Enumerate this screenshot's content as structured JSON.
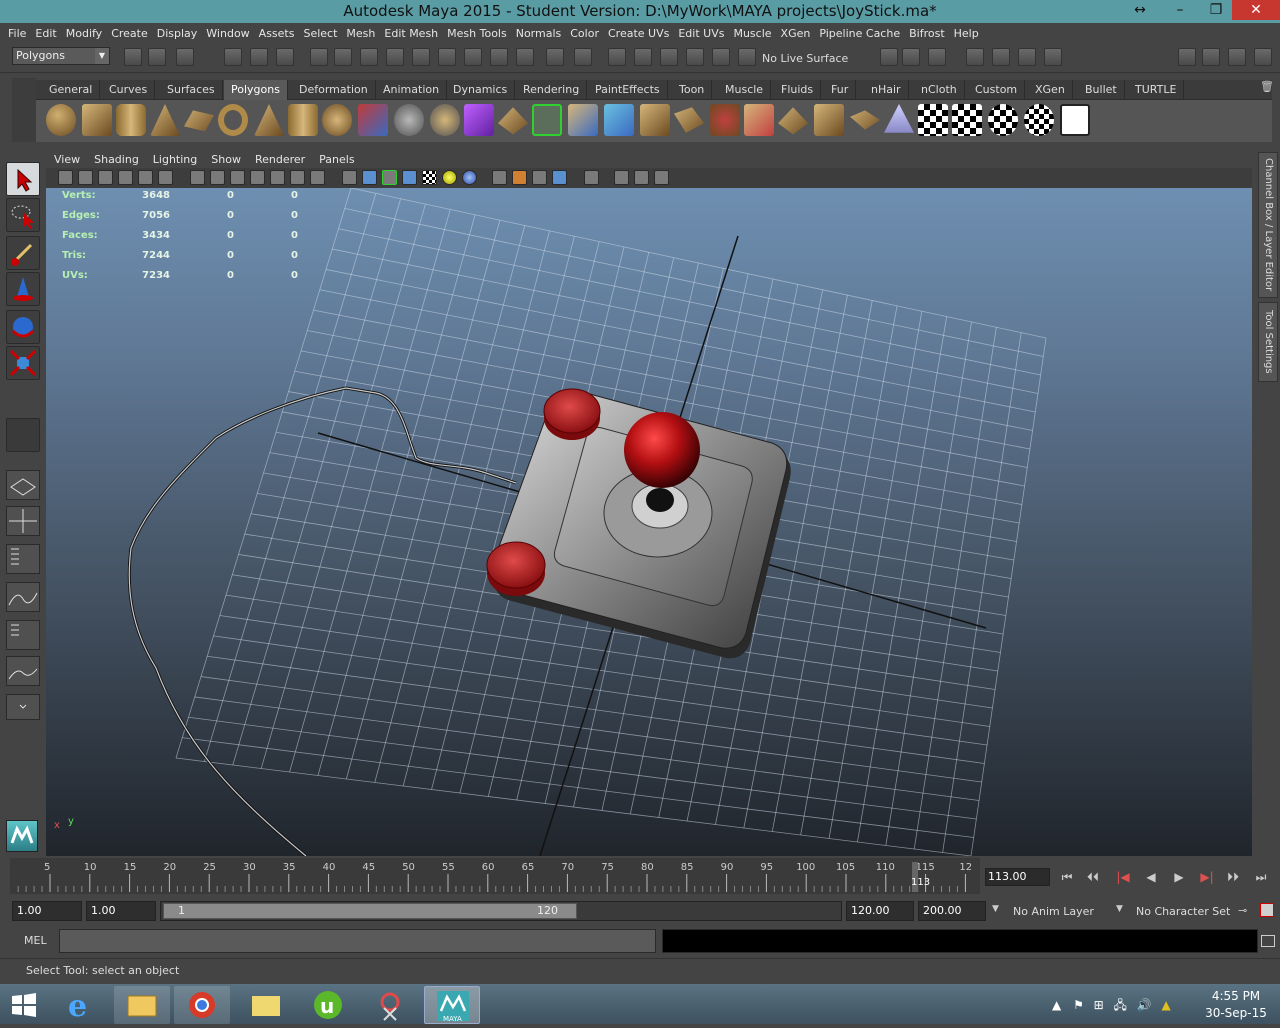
{
  "window": {
    "title": "Autodesk Maya 2015 - Student Version: D:\\MyWork\\MAYA projects\\JoyStick.ma*",
    "restore_glyph": "↔",
    "min_glyph": "–",
    "max_glyph": "❐",
    "close_glyph": "✕"
  },
  "menubar": [
    "File",
    "Edit",
    "Modify",
    "Create",
    "Display",
    "Window",
    "Assets",
    "Select",
    "Mesh",
    "Edit Mesh",
    "Mesh Tools",
    "Normals",
    "Color",
    "Create UVs",
    "Edit UVs",
    "Muscle",
    "XGen",
    "Pipeline Cache",
    "Bifrost",
    "Help"
  ],
  "toolbar": {
    "mode": "Polygons",
    "live_surface": "No Live Surface"
  },
  "shelf_tabs": [
    "General",
    "Curves",
    "Surfaces",
    "Polygons",
    "Deformation",
    "Animation",
    "Dynamics",
    "Rendering",
    "PaintEffects",
    "Toon",
    "Muscle",
    "Fluids",
    "Fur",
    "nHair",
    "nCloth",
    "Custom",
    "XGen",
    "Bullet",
    "TURTLE"
  ],
  "shelf_active": "Polygons",
  "panel_menu": [
    "View",
    "Shading",
    "Lighting",
    "Show",
    "Renderer",
    "Panels"
  ],
  "hud": [
    {
      "label": "Verts:",
      "a": "3648",
      "b": "0",
      "c": "0"
    },
    {
      "label": "Edges:",
      "a": "7056",
      "b": "0",
      "c": "0"
    },
    {
      "label": "Faces:",
      "a": "3434",
      "b": "0",
      "c": "0"
    },
    {
      "label": "Tris:",
      "a": "7244",
      "b": "0",
      "c": "0"
    },
    {
      "label": "UVs:",
      "a": "7234",
      "b": "0",
      "c": "0"
    }
  ],
  "side_tabs": {
    "channel_box": "Channel Box / Layer Editor",
    "tool_settings": "Tool Settings"
  },
  "axis": {
    "x": "x",
    "y": "y"
  },
  "timeline": {
    "ticks": [
      "5",
      "10",
      "15",
      "20",
      "25",
      "30",
      "35",
      "40",
      "45",
      "50",
      "55",
      "60",
      "65",
      "70",
      "75",
      "80",
      "85",
      "90",
      "95",
      "100",
      "105",
      "110",
      "115",
      "12"
    ],
    "current_frame_label": "113",
    "current_time": "113.00",
    "playback_glyphs": [
      "⏮",
      "⏴⏴",
      "|◀",
      "◀",
      "▶",
      "▶|",
      "⏵⏵",
      "⏭"
    ]
  },
  "range": {
    "start": "1.00",
    "start2": "1.00",
    "handle_start": "1",
    "handle_end": "120",
    "end": "120.00",
    "end2": "200.00",
    "anim_layer": "No Anim Layer",
    "char_set": "No Character Set"
  },
  "cmd": {
    "mel": "MEL"
  },
  "help": {
    "text": "Select Tool: select an object"
  },
  "taskbar": {
    "time": "4:55 PM",
    "date": "30-Sep-15",
    "maya_label": "MAYA"
  },
  "colors": {
    "title_bg": "#5a9ca4",
    "accent_red": "#b30f12",
    "viewport_top": "#6e8fb1",
    "viewport_bottom": "#20252c"
  }
}
